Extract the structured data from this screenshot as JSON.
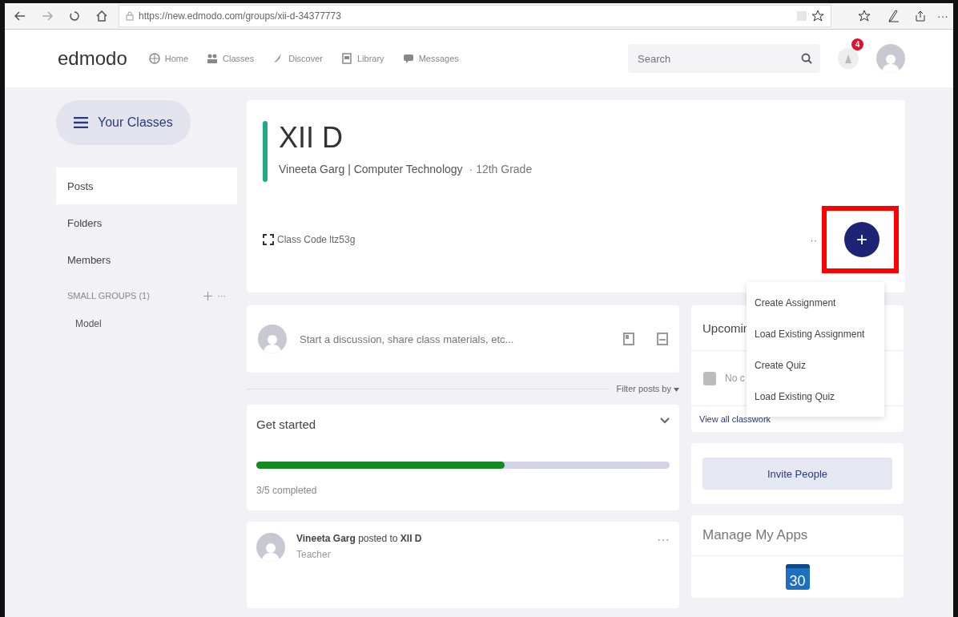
{
  "browser": {
    "url": "https://new.edmodo.com/groups/xii-d-34377773",
    "more": "···"
  },
  "nav": {
    "logo": "edmodo",
    "items": [
      {
        "label": "Home"
      },
      {
        "label": "Classes"
      },
      {
        "label": "Discover"
      },
      {
        "label": "Library"
      },
      {
        "label": "Messages"
      }
    ],
    "search": {
      "placeholder": "Search"
    },
    "notification_count": "4"
  },
  "sidebar": {
    "your_classes": "Your Classes",
    "items": [
      {
        "label": "Posts",
        "selected": true
      },
      {
        "label": "Folders",
        "selected": false
      },
      {
        "label": "Members",
        "selected": false
      }
    ],
    "small_groups": {
      "label": "SMALL GROUPS (1)",
      "more": "···",
      "groups": [
        "Model"
      ]
    }
  },
  "class_header": {
    "title": "XII D",
    "subtitle": "Vineeta Garg | Computer Technology",
    "grade": "· 12th Grade",
    "class_code": "Class Code ltz53g",
    "more": "··",
    "add": "+"
  },
  "menu": {
    "items": [
      "Create Assignment",
      "Load Existing Assignment",
      "Create Quiz",
      "Load Existing Quiz"
    ]
  },
  "composer": {
    "placeholder": "Start a discussion, share class materials, etc..."
  },
  "filter": "Filter posts by",
  "get_started": {
    "title": "Get started",
    "level": 0.6,
    "progress": "3/5 completed"
  },
  "post": {
    "header": "**Vineeta Garg** posted to **XII D**",
    "role": "Teacher",
    "more": "···"
  },
  "upcoming": {
    "title": "Upcomin",
    "empty": "No c",
    "link": "View all classwork"
  },
  "invite": "Invite People",
  "apps": {
    "title": "Manage My Apps",
    "calendar_day": "30"
  }
}
